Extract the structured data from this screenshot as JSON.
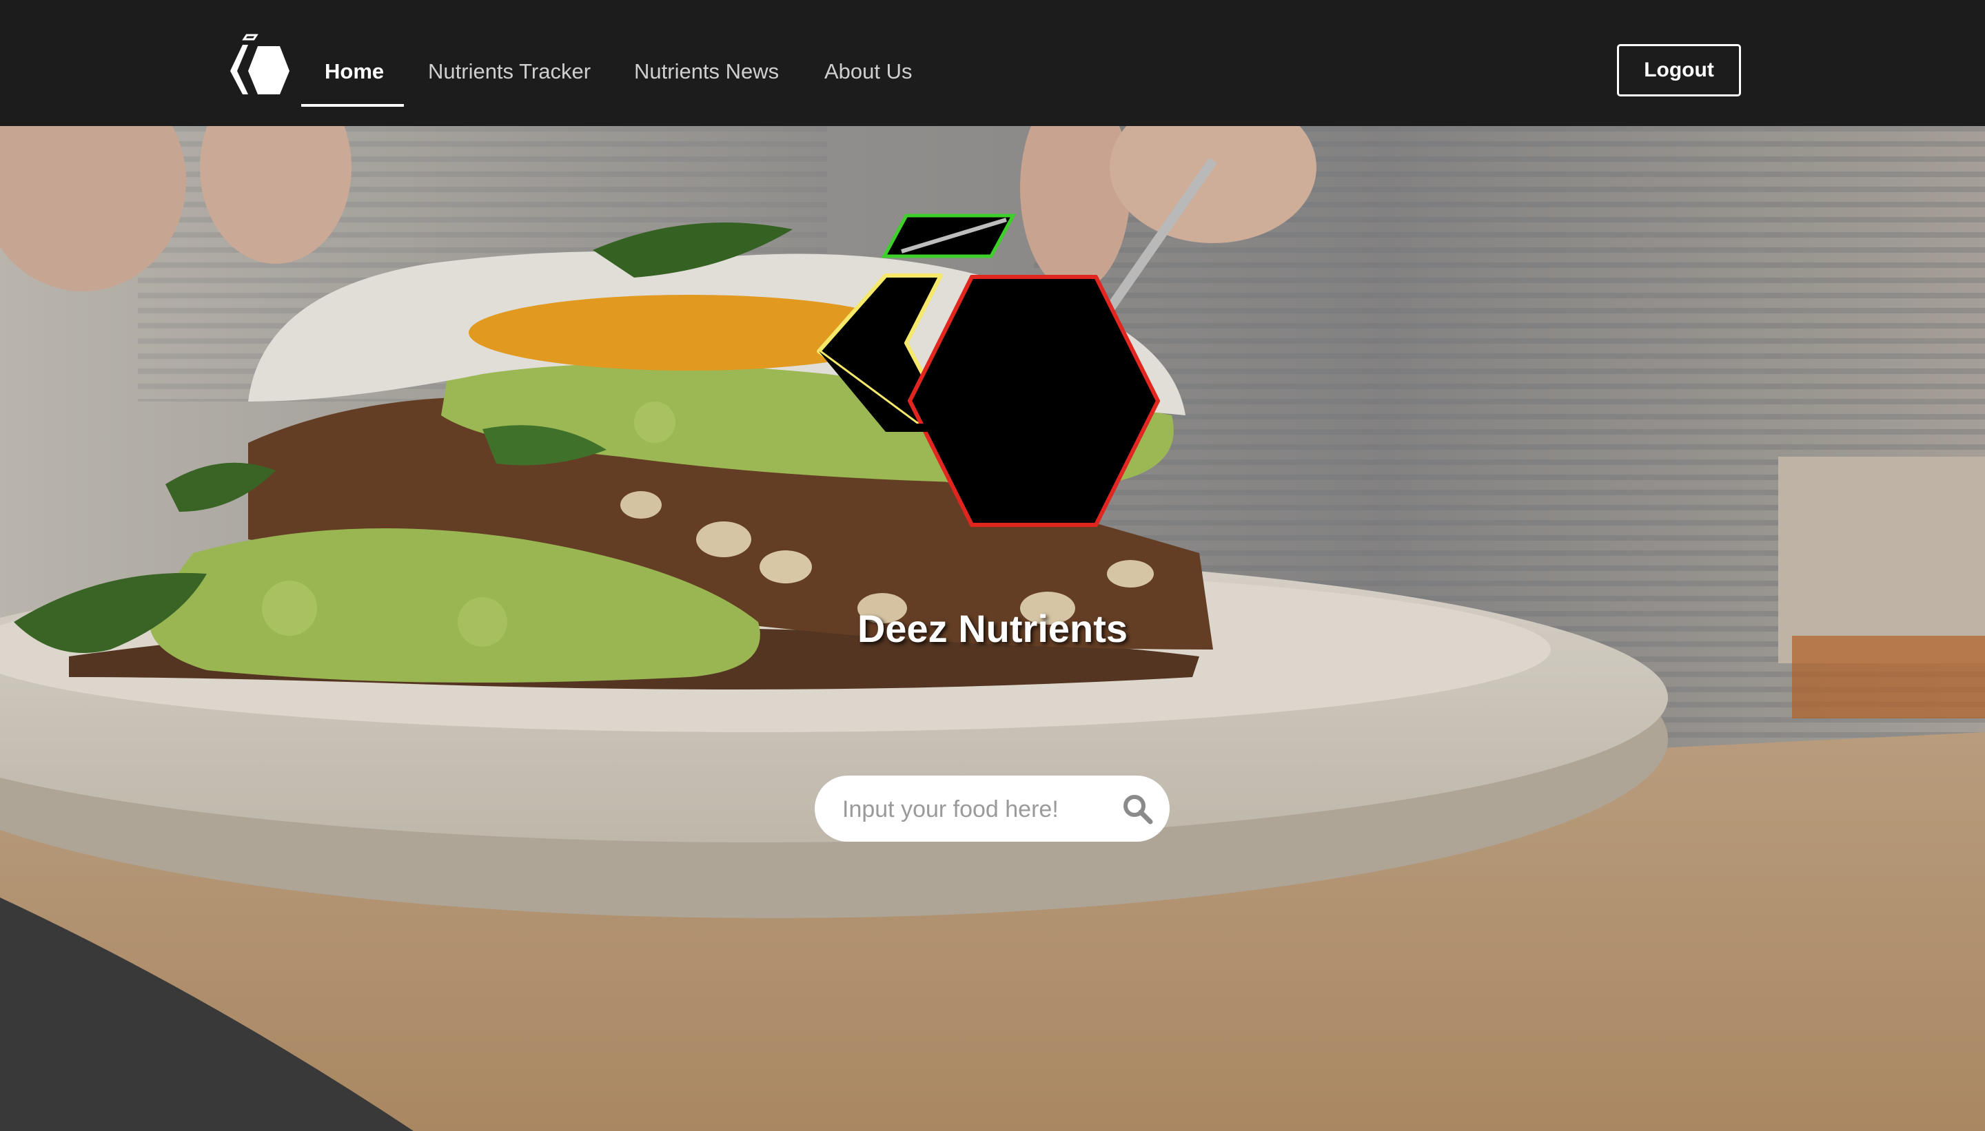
{
  "nav": {
    "logo_icon": "deez-nutrients-logo-icon",
    "links": [
      {
        "label": "Home",
        "active": true
      },
      {
        "label": "Nutrients Tracker",
        "active": false
      },
      {
        "label": "Nutrients News",
        "active": false
      },
      {
        "label": "About Us",
        "active": false
      }
    ],
    "logout_label": "Logout"
  },
  "hero": {
    "background": "avocado-toast-with-egg-photo",
    "logo_icon": "deez-nutrients-logo-icon",
    "title": "Deez Nutrients"
  },
  "search": {
    "placeholder": "Input your food here!",
    "value": "",
    "icon": "search-icon"
  },
  "colors": {
    "navbar_bg": "#1c1c1c",
    "logo_green": "#3ecf2a",
    "logo_yellow": "#f5e86a",
    "logo_red": "#e0261f"
  }
}
